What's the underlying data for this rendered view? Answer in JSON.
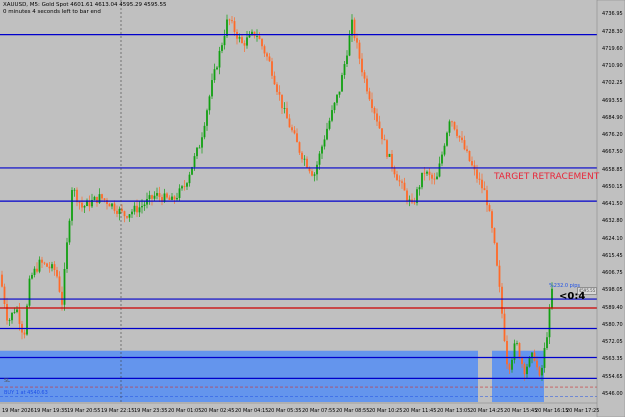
{
  "header": {
    "symbol_line": "XAUUSD, M5:  Gold Spot  4601.61 4613.04 4595.29 4595.55",
    "timer_line": "0 minutes 4 seconds left to bar end"
  },
  "annotations": {
    "target_label": "TARGET RETRACEMENT",
    "ticket_text": "<0:4",
    "pips_text": "%232.0 pips",
    "price_badge": "4595.55",
    "sl_label": "SL",
    "buy_label": "BUY 1 at 4540.63"
  },
  "chart_data": {
    "type": "candlestick",
    "symbol": "XAUUSD",
    "timeframe": "M5",
    "y_ticks": [
      "4736.95",
      "4728.30",
      "4719.60",
      "4710.90",
      "4702.25",
      "4693.55",
      "4684.90",
      "4676.20",
      "4667.50",
      "4658.85",
      "4650.15",
      "4641.50",
      "4632.80",
      "4624.10",
      "4615.45",
      "4606.75",
      "4598.05",
      "4589.40",
      "4580.70",
      "4572.05",
      "4563.35",
      "4554.65",
      "4546.00"
    ],
    "y_range": [
      4541.9,
      4741.2
    ],
    "x_labels": [
      "19 Mar 2026",
      "19 Mar 19:35",
      "19 Mar 20:55",
      "19 Mar 22:15",
      "19 Mar 23:35",
      "20 Mar 01:05",
      "20 Mar 02:45",
      "20 Mar 04:15",
      "20 Mar 05:35",
      "20 Mar 07:55",
      "20 Mar 08:55",
      "20 Mar 10:25",
      "20 Mar 11:45",
      "20 Mar 13:05",
      "20 Mar 14:25",
      "20 Mar 15:45",
      "20 Mar 16:15",
      "20 Mar 17:25"
    ],
    "levels": [
      {
        "price": 4726.8,
        "color": "#0000cc"
      },
      {
        "price": 4659.7,
        "color": "#0000cc"
      },
      {
        "price": 4643.0,
        "color": "#0000cc"
      },
      {
        "price": 4593.7,
        "color": "#0000cc"
      },
      {
        "price": 4589.2,
        "color": "#cc0000"
      },
      {
        "price": 4578.9,
        "color": "#0000cc"
      },
      {
        "price": 4564.3,
        "color": "#0000cc"
      },
      {
        "price": 4553.8,
        "color": "#0000cc"
      }
    ],
    "dashed_levels": [
      {
        "price": 4549.4,
        "color": "#cc3333"
      },
      {
        "price": 4544.8,
        "color": "#1e50e6"
      }
    ],
    "zone": {
      "from_price": 4567.7,
      "to_price": 4541.9,
      "color": "#6495ed"
    },
    "last_price": 4595.55,
    "colors": {
      "up": "#11a011",
      "down": "#ff6a28",
      "background": "#c0c0c0",
      "level": "#0000cc"
    }
  }
}
